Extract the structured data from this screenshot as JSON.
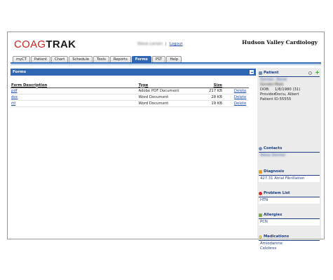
{
  "header": {
    "logo_part1": "COAG",
    "logo_part2": "TRAK",
    "user_name": "Steve Larsen",
    "logout": "Logout",
    "practice_name": "Hudson Valley Cardiology"
  },
  "tabs": [
    "myCT",
    "Patient",
    "Chart",
    "Schedule",
    "Tools",
    "Reports",
    "Forms",
    "PST",
    "Help"
  ],
  "active_tab": "Forms",
  "forms": {
    "title": "Forms",
    "columns": {
      "desc": "Form Description",
      "type": "Type",
      "size": "Size"
    },
    "rows": [
      {
        "desc": "pdf",
        "type": "Adobe PDF Document",
        "size": "217 KB",
        "action": "Delete"
      },
      {
        "desc": "doc",
        "type": "Word Document",
        "size": "28 KB",
        "action": "Delete"
      },
      {
        "desc": "rtf",
        "type": "Word Document",
        "size": "19 KB",
        "action": "Delete"
      }
    ]
  },
  "sidebar": {
    "patient": {
      "title": "Patient",
      "name": "Dernier, Steve",
      "gender_label": "Gender:",
      "gender": "Male",
      "dob_label": "DOB:",
      "dob": "1/8/1980 (31)",
      "provider_label": "Provider:",
      "provider": "Dociu, Albert",
      "pid_label": "Patient ID:",
      "pid": "55555"
    },
    "contacts": {
      "title": "Contacts",
      "item": "Steve Dernier"
    },
    "diagnosis": {
      "title": "Diagnosis",
      "item": "427.31 Atrial Fibrillation"
    },
    "problem_list": {
      "title": "Problem List",
      "item": "HTN"
    },
    "allergies": {
      "title": "Allergies",
      "item": "PCN"
    },
    "medications": {
      "title": "Medications",
      "items": [
        "Amiodarone",
        "Celebrex"
      ]
    }
  },
  "colors": {
    "accent": "#2f67b4",
    "brand_red": "#c8241f",
    "link": "#1c48a8"
  }
}
